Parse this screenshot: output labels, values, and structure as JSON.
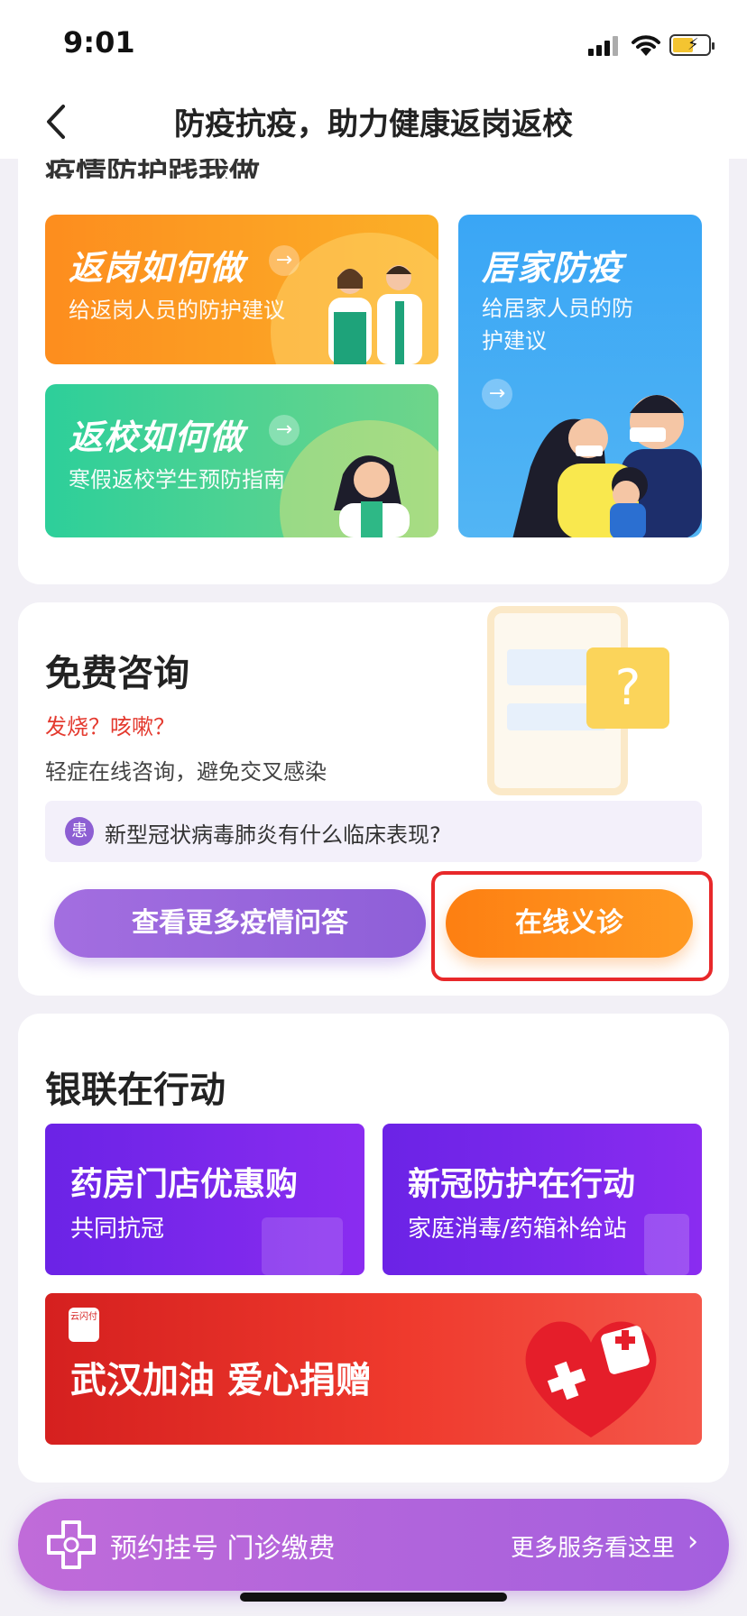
{
  "status": {
    "time": "9:01"
  },
  "nav": {
    "title": "防疫抗疫，助力健康返岗返校"
  },
  "guide": {
    "title": "疫情防护践我做",
    "tiles": [
      {
        "title": "返岗如何做",
        "subtitle": "给返岗人员的防护建议"
      },
      {
        "title": "返校如何做",
        "subtitle": "寒假返校学生预防指南"
      },
      {
        "title": "居家防疫",
        "subtitle": "给居家人员的防护建议"
      }
    ]
  },
  "consult": {
    "title": "免费咨询",
    "symptoms": "发烧？咳嗽？",
    "desc": "轻症在线咨询，避免交叉感染",
    "badge": "患",
    "question": "新型冠状病毒肺炎有什么临床表现?",
    "more_btn": "查看更多疫情问答",
    "online_btn": "在线义诊",
    "bubble": "?"
  },
  "action": {
    "title": "银联在行动",
    "promos": [
      {
        "title": "药房门店优惠购",
        "subtitle": "共同抗冠"
      },
      {
        "title": "新冠防护在行动",
        "subtitle": "家庭消毒/药箱补给站"
      }
    ],
    "banner": {
      "title": "武汉加油 爱心捐赠",
      "logo": "云闪付"
    }
  },
  "bottom": {
    "left": "预约挂号 门诊缴费",
    "right": "更多服务看这里",
    "chevron": "›"
  },
  "colors": {
    "accent_orange": "#fd7f12",
    "accent_purple": "#8e5fd8",
    "highlight_red": "#e8282a"
  }
}
